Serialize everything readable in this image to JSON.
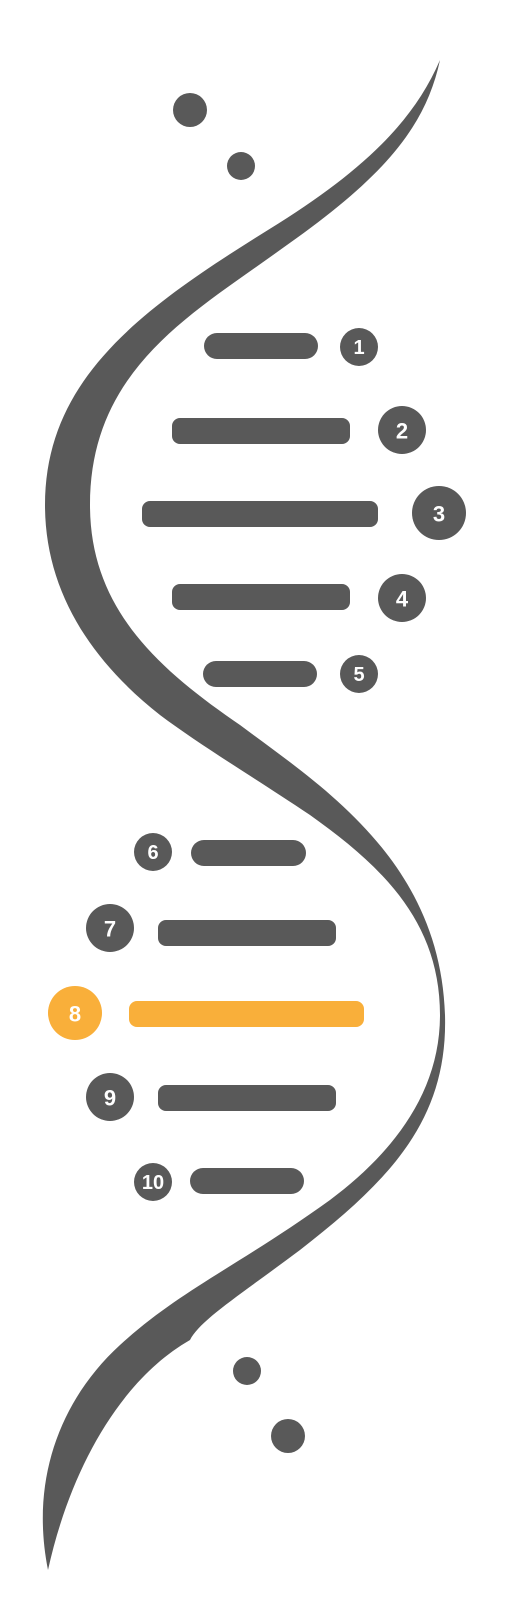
{
  "colors": {
    "primary": "#595959",
    "highlight": "#F9AF3A",
    "badge_text": "#FFFFFF"
  },
  "steps": [
    {
      "label": "1",
      "highlighted": false
    },
    {
      "label": "2",
      "highlighted": false
    },
    {
      "label": "3",
      "highlighted": false
    },
    {
      "label": "4",
      "highlighted": false
    },
    {
      "label": "5",
      "highlighted": false
    },
    {
      "label": "6",
      "highlighted": false
    },
    {
      "label": "7",
      "highlighted": false
    },
    {
      "label": "8",
      "highlighted": true
    },
    {
      "label": "9",
      "highlighted": false
    },
    {
      "label": "10",
      "highlighted": false
    }
  ]
}
